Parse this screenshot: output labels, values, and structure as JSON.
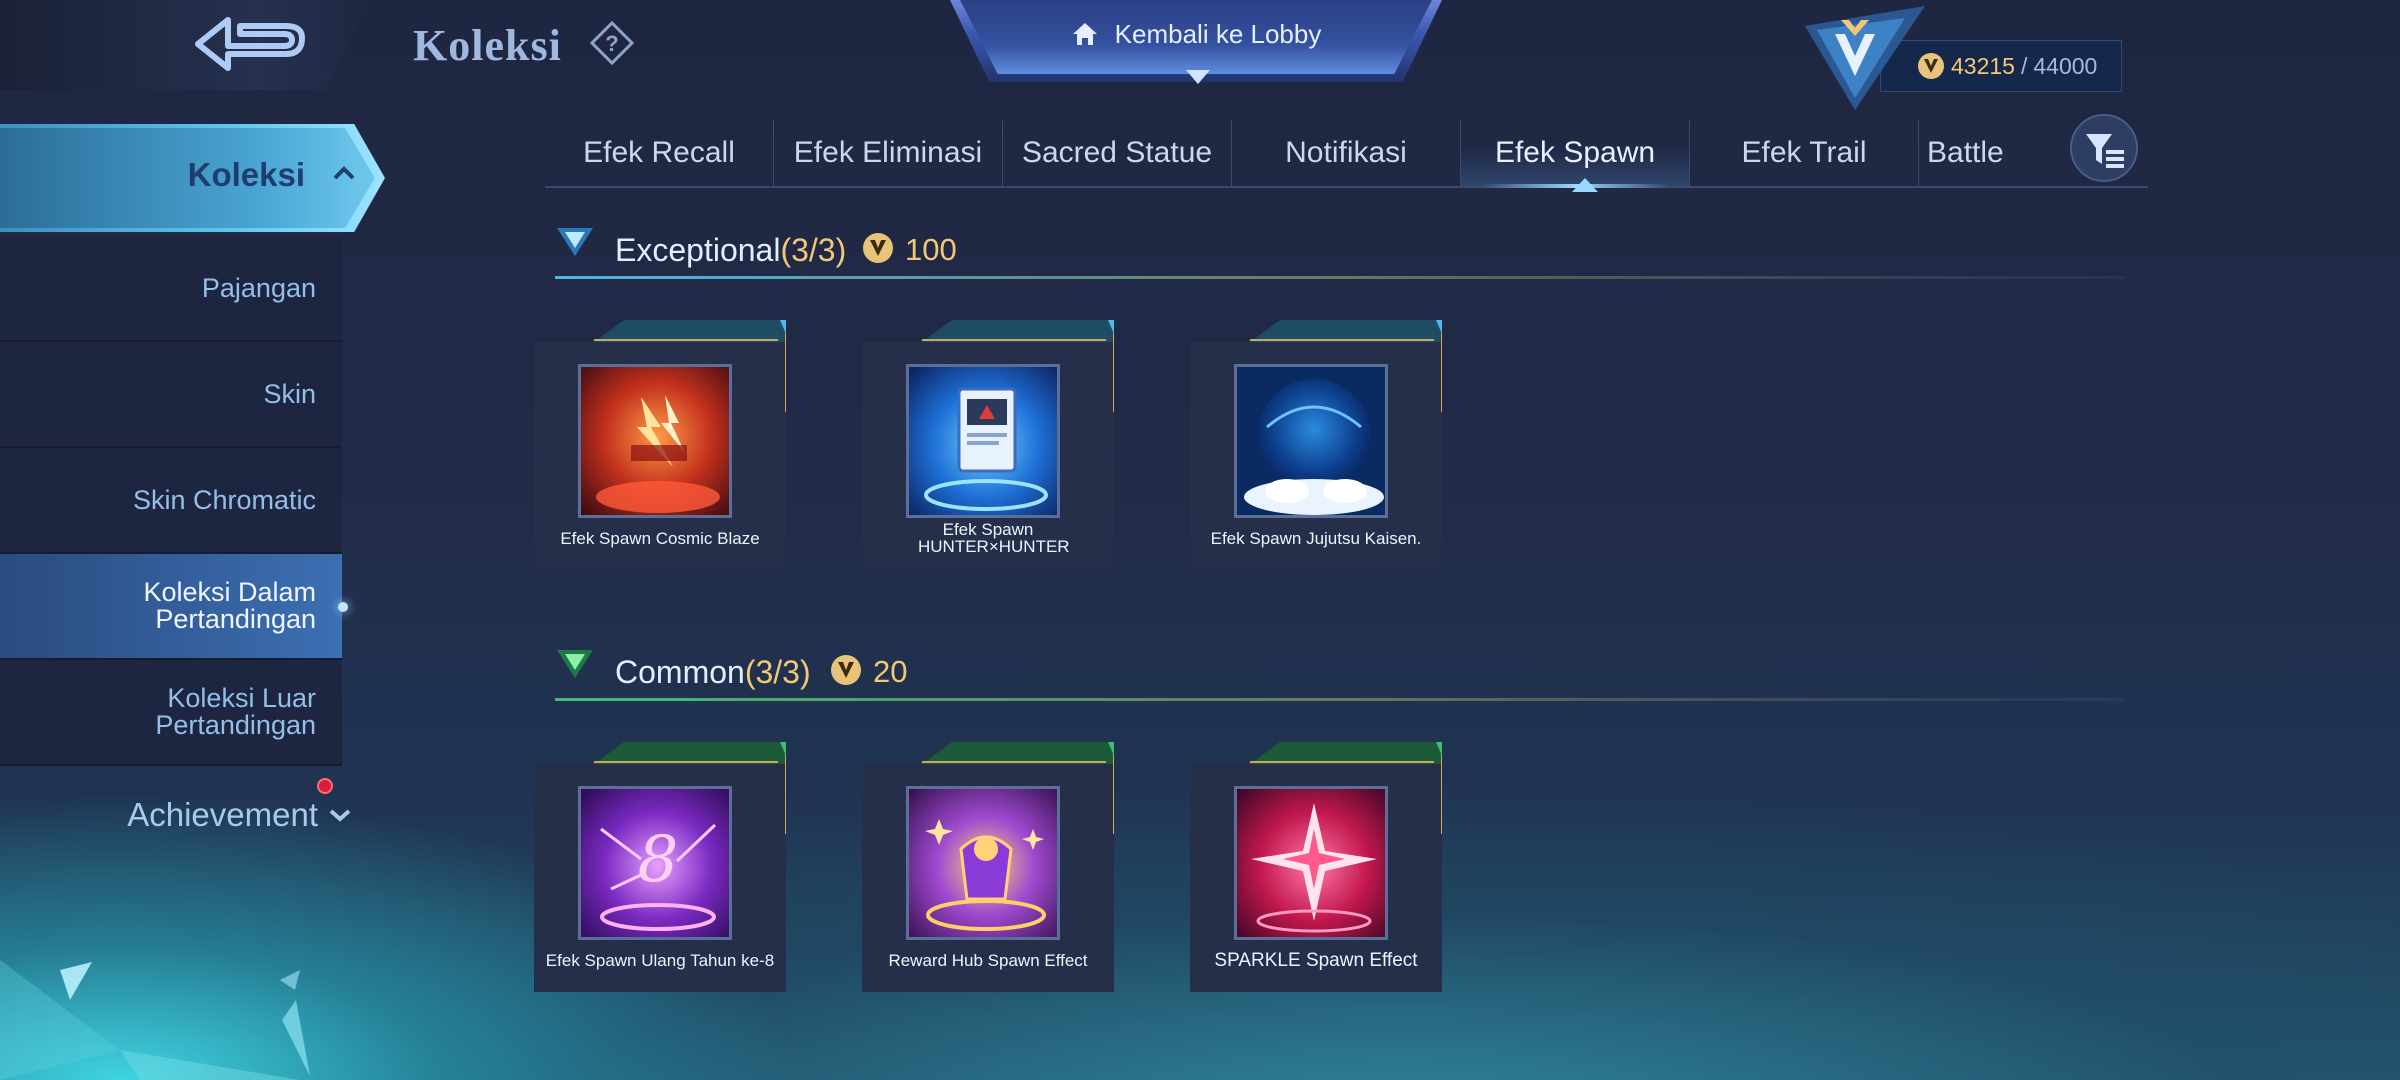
{
  "header": {
    "title": "Koleksi",
    "lobby_label": "Kembali ke Lobby",
    "currency": {
      "current": "43215",
      "max": "44000"
    }
  },
  "sidebar": {
    "head_label": "Koleksi",
    "items": [
      {
        "label": "Pajangan",
        "active": false
      },
      {
        "label": "Skin",
        "active": false
      },
      {
        "label": "Skin Chromatic",
        "active": false
      },
      {
        "label": "Koleksi Dalam Pertandingan",
        "active": true
      },
      {
        "label": "Koleksi Luar Pertandingan",
        "active": false
      }
    ],
    "achievement_label": "Achievement"
  },
  "tabs": [
    {
      "label": "Efek Recall",
      "active": false
    },
    {
      "label": "Efek Eliminasi",
      "active": false
    },
    {
      "label": "Sacred Statue",
      "active": false
    },
    {
      "label": "Notifikasi",
      "active": false
    },
    {
      "label": "Efek Spawn",
      "active": true
    },
    {
      "label": "Efek Trail",
      "active": false
    },
    {
      "label": "Battle",
      "active": false
    }
  ],
  "sections": [
    {
      "name": "Exceptional",
      "count": "(3/3)",
      "points": "100",
      "accent": "#4fb6e6",
      "items": [
        {
          "name": "Efek Spawn Cosmic Blaze",
          "art": "blaze"
        },
        {
          "name": "Efek Spawn HUNTER×HUNTER",
          "art": "hunter"
        },
        {
          "name": "Efek Spawn Jujutsu Kaisen.",
          "art": "jujutsu"
        }
      ]
    },
    {
      "name": "Common",
      "count": "(3/3)",
      "points": "20",
      "accent": "#3fbf6f",
      "items": [
        {
          "name": "Efek Spawn Ulang Tahun ke-8",
          "art": "birthday"
        },
        {
          "name": "Reward Hub Spawn Effect",
          "art": "reward"
        },
        {
          "name": "SPARKLE Spawn Effect",
          "art": "sparkle"
        }
      ]
    }
  ]
}
